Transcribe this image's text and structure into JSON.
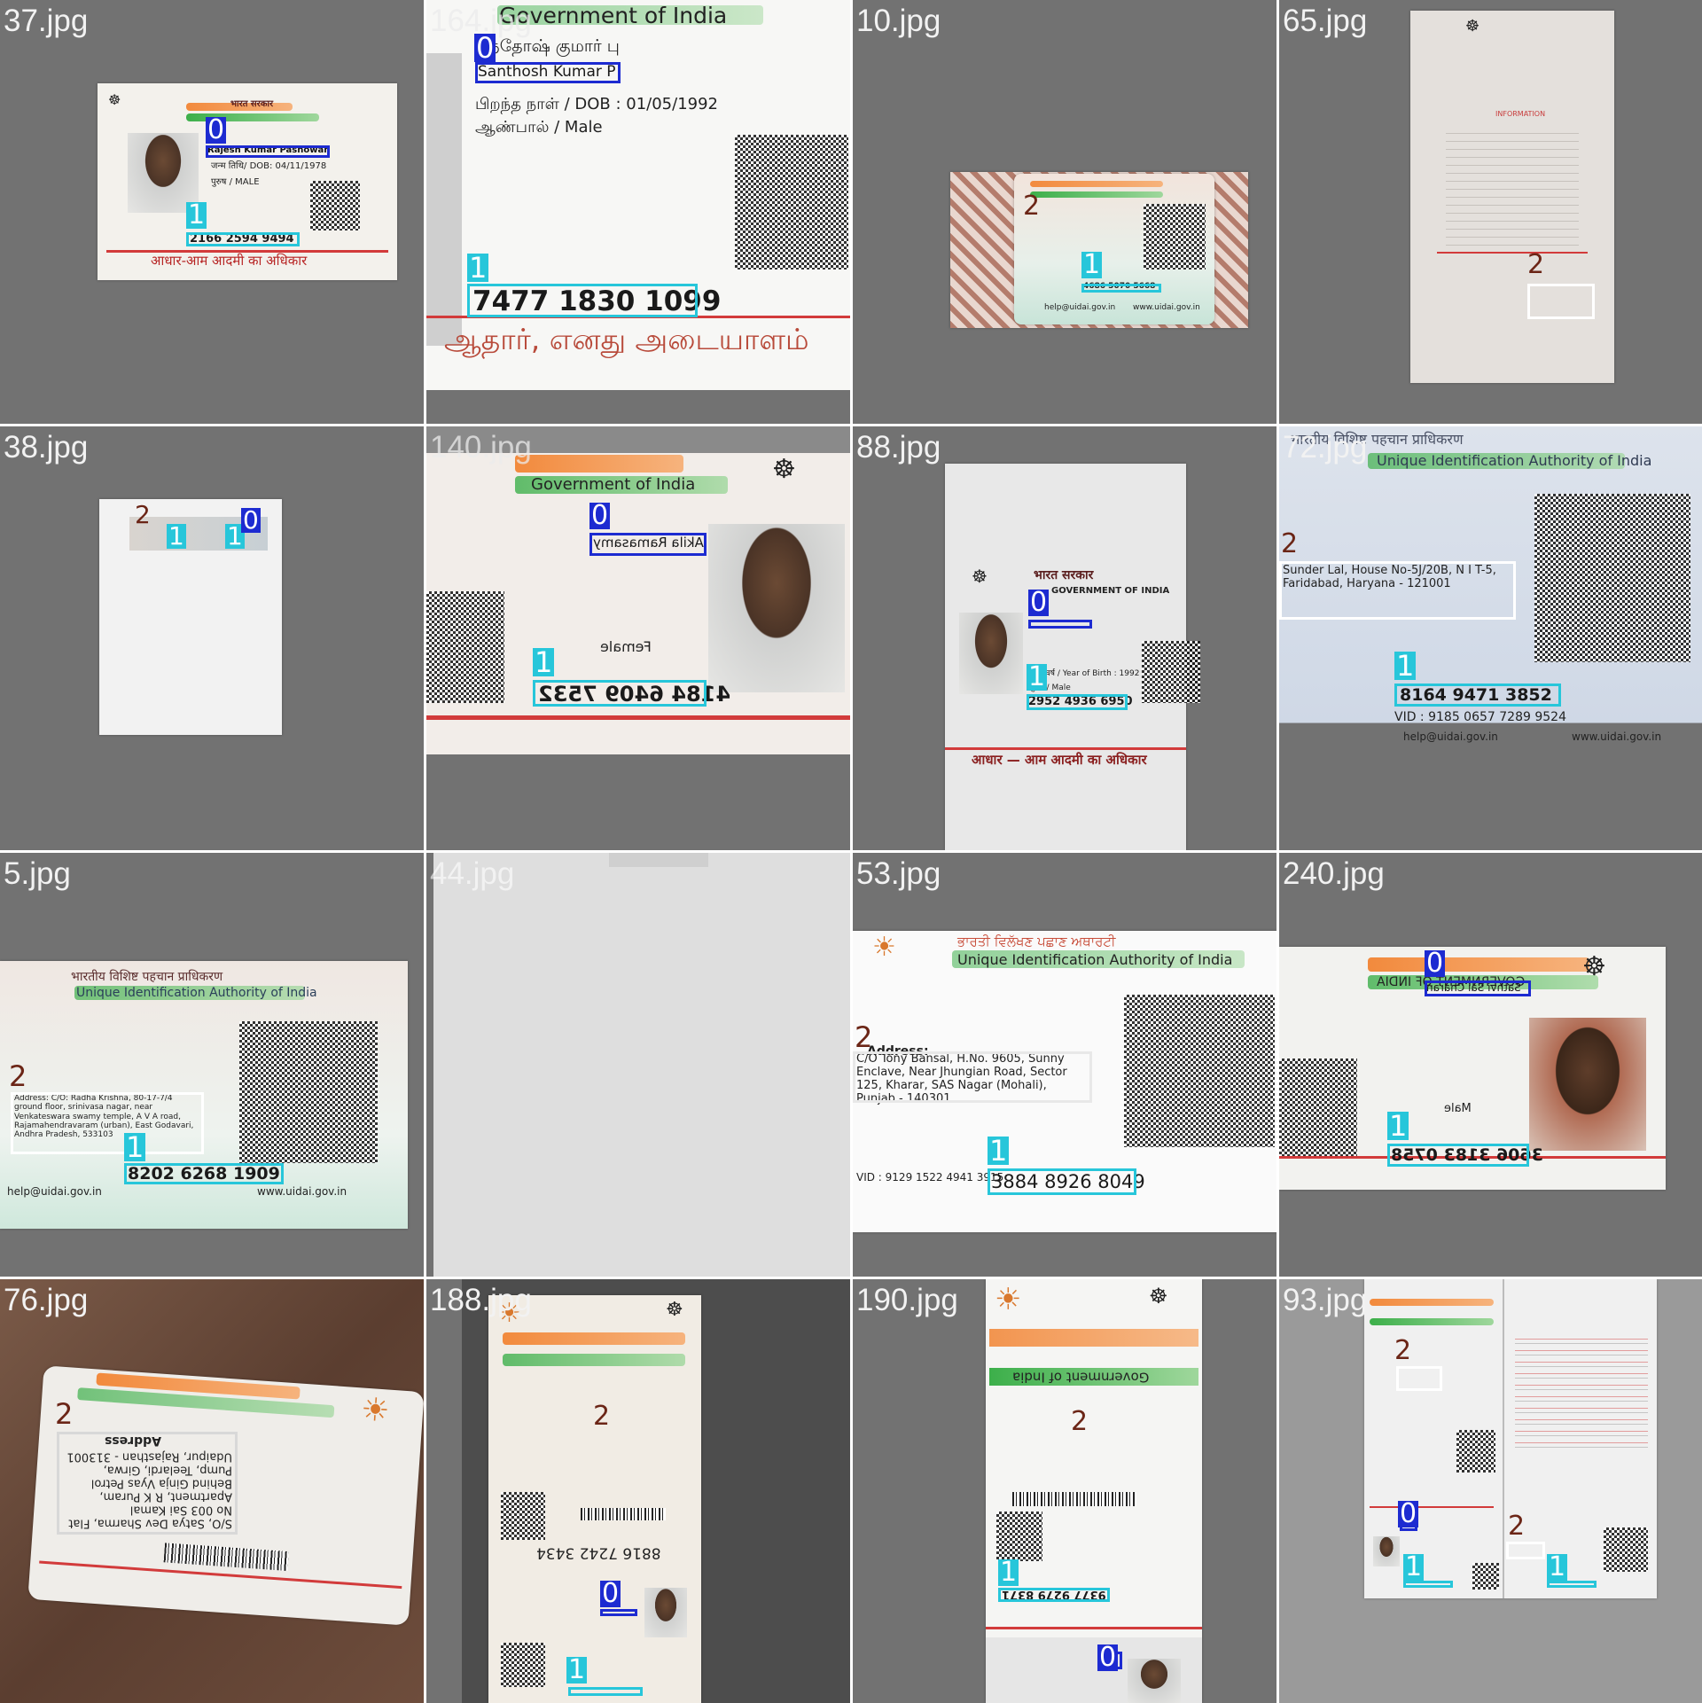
{
  "tiles": [
    {
      "name": "37.jpg",
      "n0": "Rajesh Kumar Pashowan",
      "num": "2166 2594 9494",
      "dob": "जन्म तिथि/ DOB: 04/11/1978",
      "gender": "पुरुष / MALE",
      "gov": "भारत सरकार",
      "footer": "आधार-आम आदमी का अधिकार"
    },
    {
      "name": "164.jpg",
      "top": "Government of India",
      "tname": "சந்தோஷ் குமார் பு",
      "n0": "Santhosh Kumar P",
      "dob": "பிறந்த நாள் / DOB : 01/05/1992",
      "gender": "ஆண்பால் / Male",
      "num": "7477 1830 1099",
      "footer": "ஆதார், எனது அடையாளம்"
    },
    {
      "name": "10.jpg",
      "num": "4686 5070 5668",
      "email": "help@uidai.gov.in",
      "web": "www.uidai.gov.in"
    },
    {
      "name": "65.jpg",
      "info": "INFORMATION"
    },
    {
      "name": "38.jpg"
    },
    {
      "name": "140.jpg",
      "top": "Government of India",
      "n0": "Akila Ramasamy",
      "num": "4184 6409 7532",
      "gender": "Female"
    },
    {
      "name": "88.jpg",
      "gov": "भारत सरकार",
      "gov2": "GOVERNMENT OF INDIA",
      "yob": "जन्म वर्ष / Year of Birth : 1992",
      "gender": "पुरुष / Male",
      "num": "2952 4936 6950",
      "footer": "आधार — आम आदमी का अधिकार"
    },
    {
      "name": "72.jpg",
      "hdr1": "भारतीय विशिष्ट पहचान प्राधिकरण",
      "hdr2": "Unique Identification Authority of India",
      "addr": "Sunder Lal, House No-5J/20B, N I T-5, Faridabad, Haryana - 121001",
      "num": "8164 9471 3852",
      "vid": "VID : 9185 0657 7289 9524",
      "email": "help@uidai.gov.in",
      "web": "www.uidai.gov.in"
    },
    {
      "name": "5.jpg",
      "hdr1": "भारतीय विशिष्ट पहचान प्राधिकरण",
      "hdr2": "Unique Identification Authority of India",
      "addr": "Address: C/O: Radha Krishna, 80-17-7/4 ground floor, srinivasa nagar, near Venkateswara swamy temple, A V A road, Rajamahendravaram (urban), East Godavari, Andhra Pradesh, 533103",
      "num": "8202 6268 1909",
      "email": "help@uidai.gov.in",
      "web": "www.uidai.gov.in"
    },
    {
      "name": "44.jpg"
    },
    {
      "name": "53.jpg",
      "hdr1": "ਭਾਰਤੀ ਵਿਲੱਖਣ ਪਛਾਣ ਅਥਾਰਟੀ",
      "hdr2": "Unique Identification Authority of India",
      "addr_label": "Address:",
      "addr": "C/O Tony Bansal, H.No. 9605, Sunny Enclave, Near Jhungian Road, Sector 125, Kharar, SAS Nagar (Mohali), Punjab - 140301",
      "num": "3884 8926 8049",
      "vid": "VID : 9129 1522 4941 3915"
    },
    {
      "name": "240.jpg",
      "gov": "GOVERNMENT OF INDIA",
      "n0": "Sathvi Sai Charan",
      "num": "3606 3183 0758",
      "gender": "Male"
    },
    {
      "name": "76.jpg",
      "addr_label": "Address",
      "addr": "S/O, Satya Dev Sharma, Flat No 003 Sai Kamal Apartment, R K Puram, Behind Ginja Vyas Petrol Pump, Teelardi, Girwa, Udaipur, Rajasthan - 313001"
    },
    {
      "name": "188.jpg",
      "num": "8816 7242 3434"
    },
    {
      "name": "190.jpg",
      "top": "Government of India",
      "num": "9377 9279 8371"
    },
    {
      "name": "93.jpg"
    }
  ],
  "class_labels": {
    "c0": "0",
    "c1": "1",
    "c2": "2"
  },
  "colors": {
    "class0": "#1d2bd1",
    "class1": "#27c6da",
    "class2": "#ffffff",
    "tile_bg": "#727272"
  }
}
